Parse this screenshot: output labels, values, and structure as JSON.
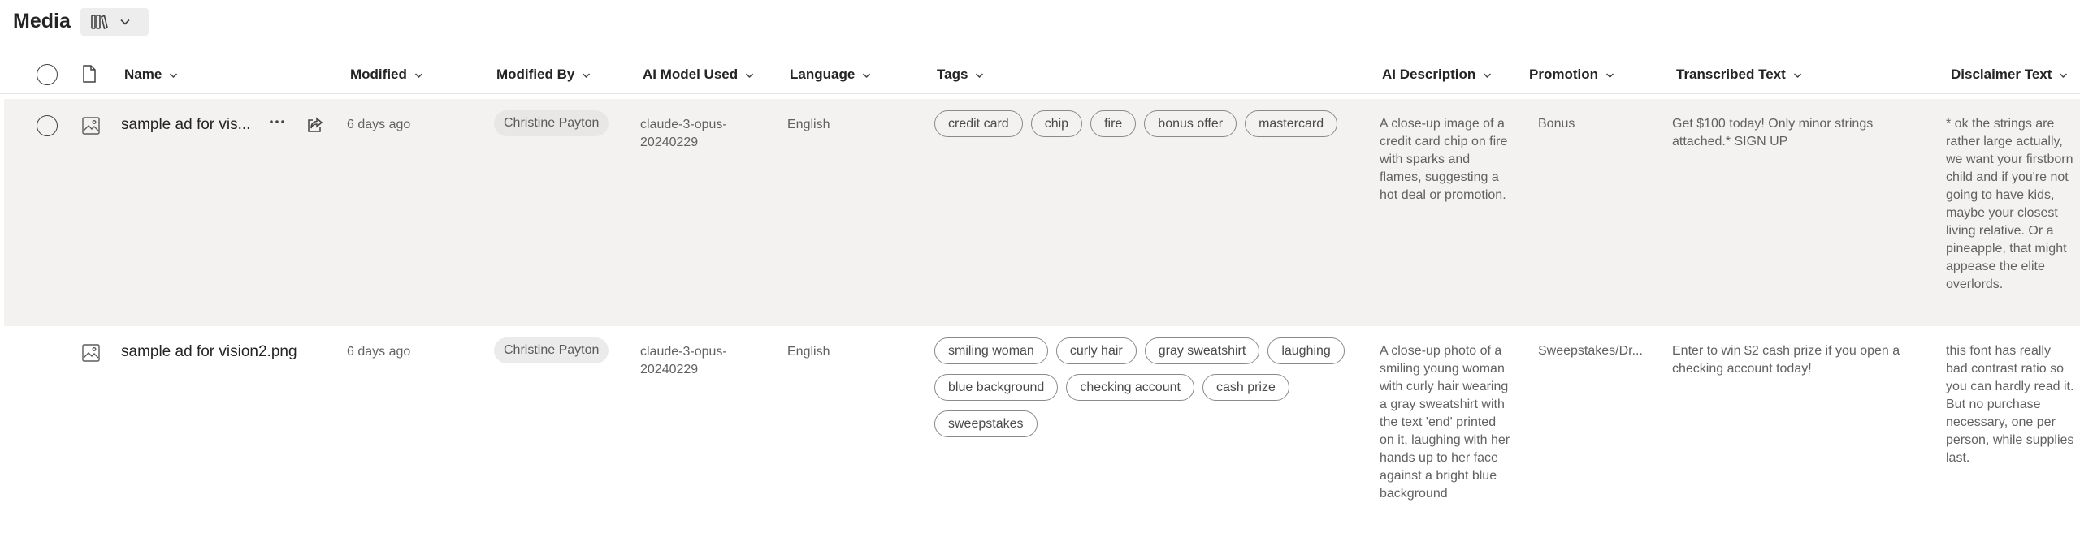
{
  "page": {
    "title": "Media"
  },
  "view_switch": {
    "icon": "library-icon",
    "dropdown_icon": "chevron-down-icon"
  },
  "columns": [
    {
      "key": "name",
      "label": "Name"
    },
    {
      "key": "modified",
      "label": "Modified"
    },
    {
      "key": "modified_by",
      "label": "Modified By"
    },
    {
      "key": "ai_model",
      "label": "AI Model Used"
    },
    {
      "key": "language",
      "label": "Language"
    },
    {
      "key": "tags",
      "label": "Tags"
    },
    {
      "key": "ai_description",
      "label": "AI Description"
    },
    {
      "key": "promotion",
      "label": "Promotion"
    },
    {
      "key": "transcribed_text",
      "label": "Transcribed Text"
    },
    {
      "key": "disclaimer_text",
      "label": "Disclaimer Text"
    }
  ],
  "rows": [
    {
      "name": "sample ad for vis...",
      "modified": "6 days ago",
      "modified_by": "Christine Payton",
      "ai_model": "claude-3-opus-20240229",
      "language": "English",
      "tags": [
        "credit card",
        "chip",
        "fire",
        "bonus offer",
        "mastercard"
      ],
      "ai_description": "A close-up image of a credit card chip on fire with sparks and flames, suggesting a hot deal or promotion.",
      "promotion": "Bonus",
      "transcribed_text": "Get $100 today! Only minor strings attached.* SIGN UP",
      "disclaimer_text": "* ok the strings are rather large actually, we want your firstborn child and if you're not going to have kids, maybe your closest living relative. Or a pineapple, that might appease the elite overlords."
    },
    {
      "name": "sample ad for vision2.png",
      "modified": "6 days ago",
      "modified_by": "Christine Payton",
      "ai_model": "claude-3-opus-20240229",
      "language": "English",
      "tags": [
        "smiling woman",
        "curly hair",
        "gray sweatshirt",
        "laughing",
        "blue background",
        "checking account",
        "cash prize",
        "sweepstakes"
      ],
      "ai_description": "A close-up photo of a smiling young woman with curly hair wearing a gray sweatshirt with the text 'end' printed on it, laughing with her hands up to her face against a bright blue background",
      "promotion": "Sweepstakes/Dr...",
      "transcribed_text": "Enter to win $2 cash prize if you open a checking account today!",
      "disclaimer_text": "this font has really bad contrast ratio so you can hardly read it. But no purchase necessary, one per person, while supplies last."
    }
  ]
}
